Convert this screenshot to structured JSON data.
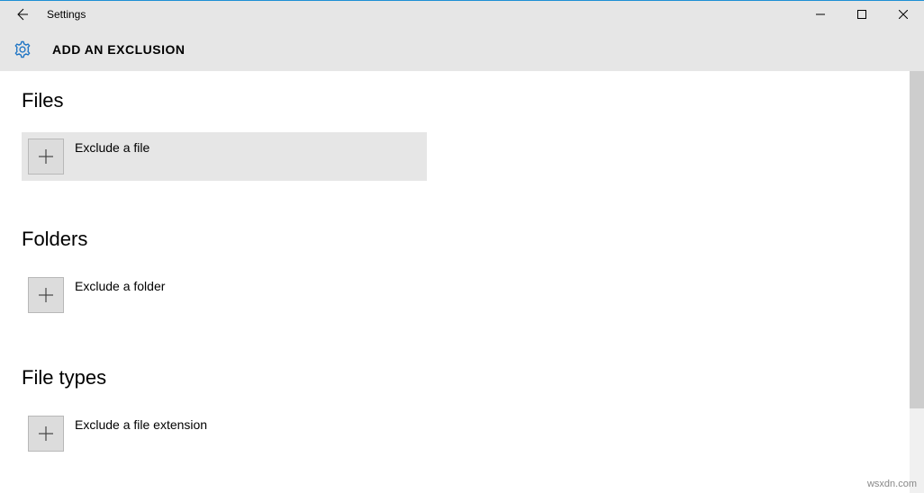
{
  "window": {
    "app_title": "Settings"
  },
  "header": {
    "page_title": "ADD AN EXCLUSION"
  },
  "sections": {
    "files": {
      "title": "Files",
      "option_label": "Exclude a file"
    },
    "folders": {
      "title": "Folders",
      "option_label": "Exclude a folder"
    },
    "file_types": {
      "title": "File types",
      "option_label": "Exclude a file extension"
    }
  },
  "watermark": "wsxdn.com"
}
